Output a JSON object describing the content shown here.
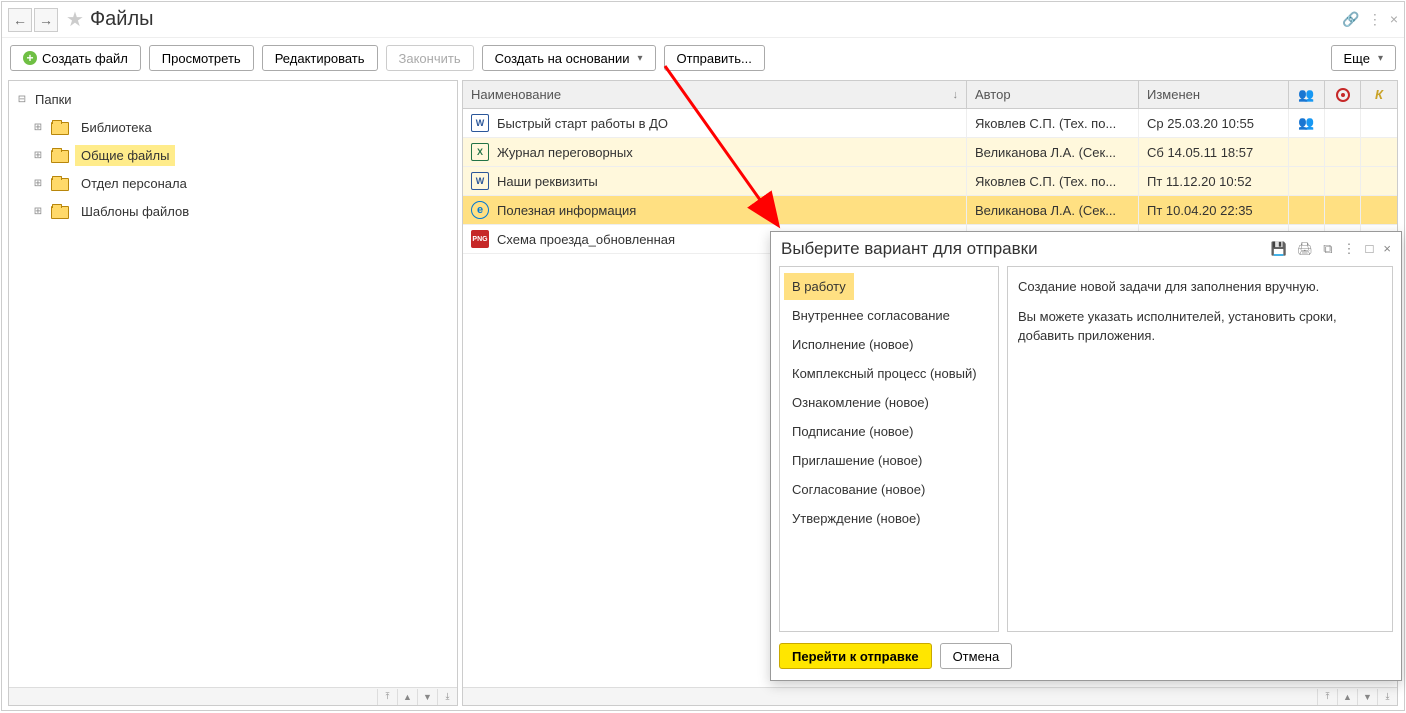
{
  "title": "Файлы",
  "toolbar": {
    "create_file": "Создать файл",
    "view": "Просмотреть",
    "edit": "Редактировать",
    "finish": "Закончить",
    "create_based": "Создать на основании",
    "send": "Отправить...",
    "more": "Еще"
  },
  "tree": {
    "root": "Папки",
    "items": [
      {
        "label": "Библиотека"
      },
      {
        "label": "Общие файлы"
      },
      {
        "label": "Отдел персонала"
      },
      {
        "label": "Шаблоны файлов"
      }
    ]
  },
  "table": {
    "headers": {
      "name": "Наименование",
      "author": "Автор",
      "modified": "Изменен"
    },
    "rows": [
      {
        "icon": "word",
        "iconText": "W",
        "name": "Быстрый старт работы в ДО",
        "author": "Яковлев С.П. (Тех. по...",
        "modified": "Ср 25.03.20 10:55",
        "people": true,
        "highlight": false
      },
      {
        "icon": "excel",
        "iconText": "X",
        "name": "Журнал переговорных",
        "author": "Великанова Л.А. (Сек...",
        "modified": "Сб 14.05.11 18:57",
        "people": false,
        "highlight": true
      },
      {
        "icon": "word",
        "iconText": "W",
        "name": "Наши реквизиты",
        "author": "Яковлев С.П. (Тех. по...",
        "modified": "Пт 11.12.20 10:52",
        "people": false,
        "highlight": true
      },
      {
        "icon": "edge",
        "iconText": "e",
        "name": "Полезная информация",
        "author": "Великанова Л.А. (Сек...",
        "modified": "Пт 10.04.20 22:35",
        "people": false,
        "highlight": true,
        "selected": true
      },
      {
        "icon": "png",
        "iconText": "PNG",
        "name": "Схема проезда_обновленная",
        "author": "",
        "modified": "",
        "people": false,
        "highlight": false
      }
    ]
  },
  "dialog": {
    "title": "Выберите вариант для отправки",
    "options": [
      "В работу",
      "Внутреннее согласование",
      "Исполнение (новое)",
      "Комплексный процесс (новый)",
      "Ознакомление (новое)",
      "Подписание (новое)",
      "Приглашение (новое)",
      "Согласование (новое)",
      "Утверждение (новое)"
    ],
    "description": {
      "line1": "Создание новой задачи для заполнения вручную.",
      "line2": "Вы можете указать исполнителей, установить сроки, добавить приложения."
    },
    "primary_btn": "Перейти к отправке",
    "cancel_btn": "Отмена"
  }
}
